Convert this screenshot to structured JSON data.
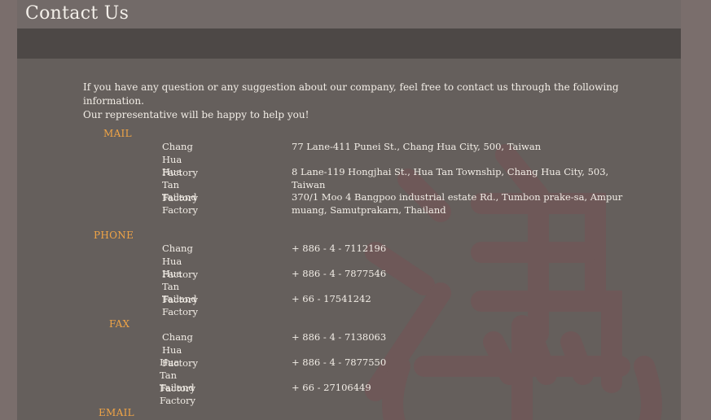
{
  "page": {
    "title": "Contact Us",
    "intro_line1": "If you have any question or any suggestion about our company,  feel free to contact us through the following information.",
    "intro_line2": "Our representative will be happy to help you!"
  },
  "mail": {
    "heading": "MAIL",
    "rows": [
      {
        "label": "Chang Hua Factory",
        "value": "77 Lane-411 Punei St., Chang Hua City, 500, Taiwan"
      },
      {
        "label": "Hua Tan Factory",
        "value": "8 Lane-119 Hongjhai St., Hua Tan Township, Chang Hua City, 503, Taiwan"
      },
      {
        "label": "Tailand Factory",
        "value": "370/1 Moo 4 Bangpoo industrial estate Rd., Tumbon prake-sa, Ampur muang, Samutprakarn, Thailand"
      }
    ]
  },
  "phone": {
    "heading": "PHONE",
    "rows": [
      {
        "label": "Chang Hua Factory",
        "value": "+ 886 - 4 - 7112196"
      },
      {
        "label": "Hua Tan Factory",
        "value": "+ 886 - 4 - 7877546"
      },
      {
        "label": "Tailand Factory",
        "value": "+ 66 - 17541242"
      }
    ]
  },
  "fax": {
    "heading": "FAX",
    "rows": [
      {
        "label": "Chang Hua Factory",
        "value": "+ 886 - 4 - 7138063"
      },
      {
        "label": "Hua Tan Factory",
        "value": "+ 886 - 4 - 7877550"
      },
      {
        "label": "Tailand Factory",
        "value": "+ 66 - 27106449"
      }
    ]
  },
  "email": {
    "heading": "EMAIL"
  },
  "colors": {
    "accent": "#f0a446",
    "panel": "#655f5c",
    "band": "#4d4846",
    "watermark": "#6f5a5a"
  },
  "icons": {
    "watermark": "company-logo-watermark"
  }
}
